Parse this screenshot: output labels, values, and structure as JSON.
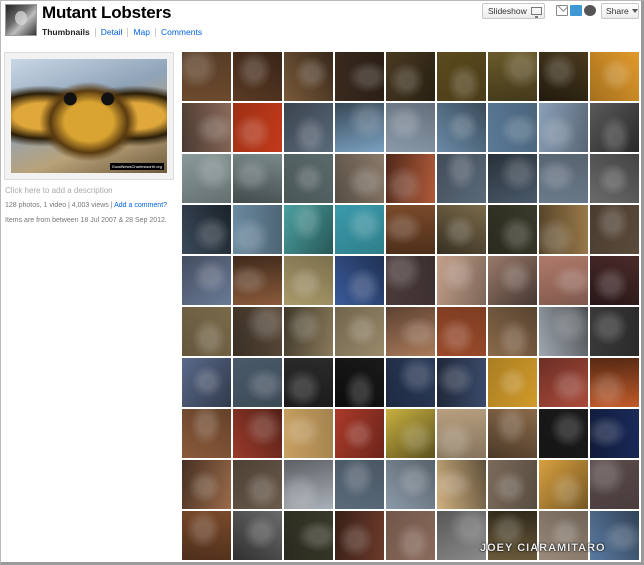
{
  "set": {
    "title": "Mutant Lobsters",
    "tabs": [
      "Thumbnails",
      "Detail",
      "Map",
      "Comments"
    ],
    "active_tab": "Thumbnails"
  },
  "toolbar": {
    "slideshow_label": "Slideshow",
    "share_label": "Share",
    "share_icons": [
      "mail-icon",
      "twitter-icon",
      "wordpress-icon"
    ]
  },
  "sidebar": {
    "cover_credit": "GoodNewsCharlesworth.org",
    "description_placeholder": "Click here to add a description",
    "stats_text": "128 photos, 1 video | 4,003 views | ",
    "add_comment_label": "Add a comment?",
    "date_range": "Items are from between 18 Jul 2007 & 28 Sep 2012."
  },
  "thumbnails": {
    "colors": [
      "#6b4a2e",
      "#5a3a24",
      "#7a5a3a",
      "#3a2a1e",
      "#4a3a22",
      "#5b4a1e",
      "#6a5a2a",
      "#4a3a1e",
      "#e29a2a",
      "#8a6a5a",
      "#c23a1a",
      "#5a6a7a",
      "#7aa0c0",
      "#8a9aaa",
      "#6a8aa6",
      "#5a7a96",
      "#8aa0b8",
      "#5a5a5a",
      "#8a9a9a",
      "#7a8a8a",
      "#5a6a6a",
      "#8a7a6a",
      "#b05a3a",
      "#5a6a7a",
      "#4a5a6a",
      "#6a7a8a",
      "#6a6a6a",
      "#3a4a5a",
      "#6a8aa0",
      "#4aa0a0",
      "#3a9aaa",
      "#7a4a2a",
      "#7a6a4a",
      "#3a3a2a",
      "#9a7a4a",
      "#5a4a3a",
      "#6a7a96",
      "#8a5a3a",
      "#aa9a6a",
      "#3a5a9a",
      "#4a3a3a",
      "#c4a08a",
      "#9a7a6a",
      "#b07a6a",
      "#4a2a2a",
      "#7a6a4a",
      "#5a4a3a",
      "#8a7a5a",
      "#9a8a6a",
      "#aa7a5a",
      "#9a4a2a",
      "#8a6a4a",
      "#a0a8b0",
      "#3a3a3a",
      "#5a6a8a",
      "#4a5a6a",
      "#2a2a2a",
      "#1a1a1a",
      "#2a3a5a",
      "#3a4a6a",
      "#d09a2a",
      "#aa4a3a",
      "#c05a2a",
      "#8a5a3a",
      "#9a3a2a",
      "#c8a060",
      "#aa3a2a",
      "#c8b040",
      "#b8a080",
      "#8a6a4a",
      "#1a1a1a",
      "#1a2a5a",
      "#9a6a4a",
      "#6a5a4a",
      "#aab0b8",
      "#5a6a7a",
      "#8a9aa8",
      "#d0b080",
      "#7a6a5a",
      "#d8a040",
      "#5a4a4a",
      "#7a4a2a",
      "#6a6a6a",
      "#3a3a2a",
      "#6a3a2a",
      "#8a6a5a",
      "#8a8a8a",
      "#6a5a3a",
      "#9a8a7a",
      "#5a7aa0"
    ]
  },
  "watermark": "JOEY CIARAMITARO"
}
